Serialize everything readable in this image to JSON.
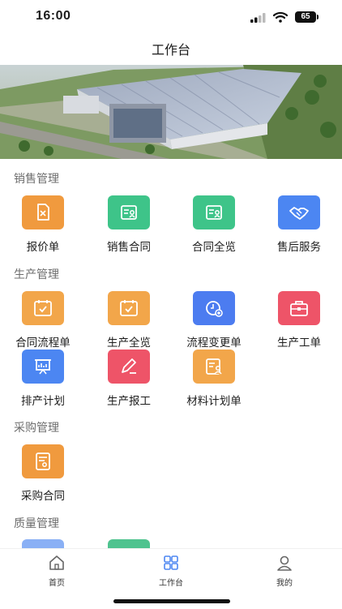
{
  "status": {
    "time": "16:00",
    "battery": "65"
  },
  "header": {
    "title": "工作台"
  },
  "sections": [
    {
      "title": "销售管理",
      "items": [
        {
          "label": "报价单",
          "icon": "quote-icon",
          "color": "#F09A3E"
        },
        {
          "label": "销售合同",
          "icon": "contract-icon",
          "color": "#3EC489"
        },
        {
          "label": "合同全览",
          "icon": "contract-overview-icon",
          "color": "#3EC489"
        },
        {
          "label": "售后服务",
          "icon": "handshake-icon",
          "color": "#4C86F2"
        }
      ]
    },
    {
      "title": "生产管理",
      "items": [
        {
          "label": "合同流程单",
          "icon": "calendar-check-icon",
          "color": "#F2A64A"
        },
        {
          "label": "生产全览",
          "icon": "calendar-check-icon",
          "color": "#F2A64A"
        },
        {
          "label": "流程变更单",
          "icon": "clock-add-icon",
          "color": "#4C7CF0"
        },
        {
          "label": "生产工单",
          "icon": "briefcase-icon",
          "color": "#EE5468"
        },
        {
          "label": "排产计划",
          "icon": "chart-board-icon",
          "color": "#4C86F2"
        },
        {
          "label": "生产报工",
          "icon": "pen-icon",
          "color": "#EE5468"
        },
        {
          "label": "材料计划单",
          "icon": "document-user-icon",
          "color": "#F2A64A"
        }
      ]
    },
    {
      "title": "采购管理",
      "items": [
        {
          "label": "采购合同",
          "icon": "certificate-icon",
          "color": "#F09A3E"
        }
      ]
    },
    {
      "title": "质量管理",
      "items": [
        {
          "label": "",
          "icon": "quality-icon-1",
          "color": "#8AB0F5"
        },
        {
          "label": "",
          "icon": "quality-icon-2",
          "color": "#4FC38F"
        }
      ]
    }
  ],
  "tabbar": {
    "tabs": [
      {
        "label": "首页",
        "icon": "home-icon",
        "active": false
      },
      {
        "label": "工作台",
        "icon": "grid-icon",
        "active": true
      },
      {
        "label": "我的",
        "icon": "user-icon",
        "active": false
      }
    ],
    "active_color": "#4C86F2"
  }
}
